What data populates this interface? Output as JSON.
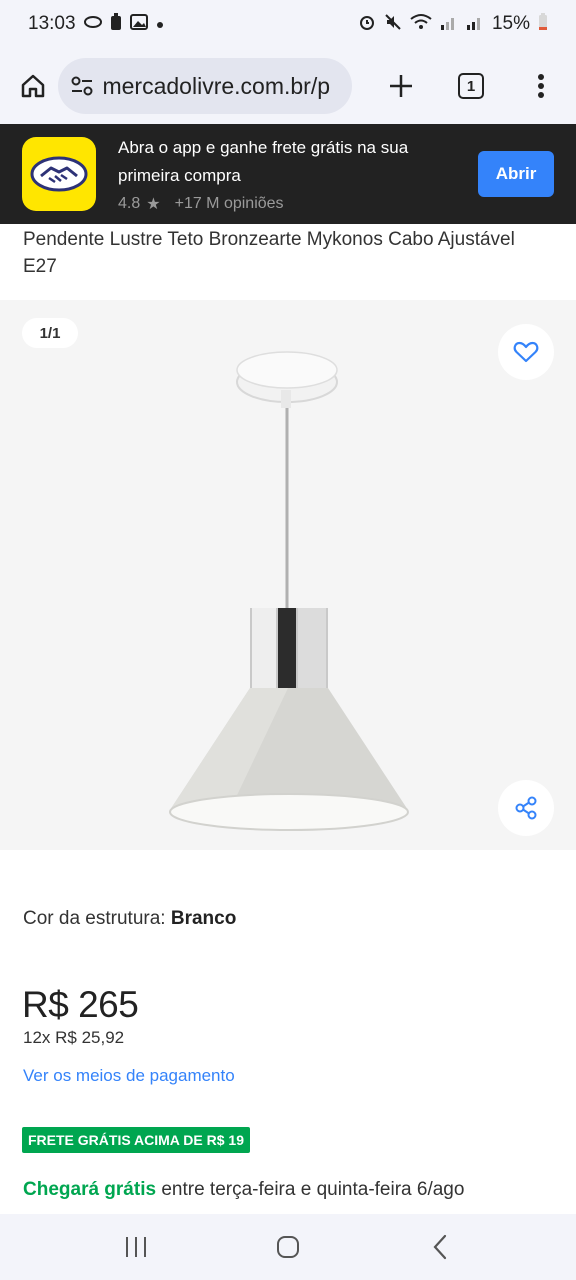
{
  "status_bar": {
    "time": "13:03",
    "battery": "15%",
    "icons_left": [
      "whatsapp-icon",
      "battery-saver-icon",
      "image-icon",
      "dot-icon"
    ],
    "icons_right": [
      "alarm-icon",
      "mute-icon",
      "wifi-icon",
      "signal-icon",
      "signal-icon"
    ]
  },
  "browser": {
    "url": "mercadolivre.com.br/p",
    "tab_count": "1"
  },
  "app_banner": {
    "title": "Abra o app e ganhe frete grátis na sua primeira compra",
    "rating": "4.8",
    "reviews": "+17 M opiniões",
    "open_label": "Abrir",
    "brand_color": "#ffe600",
    "button_color": "#3483fa"
  },
  "product": {
    "title": "Pendente Lustre Teto Bronzearte Mykonos Cabo Ajustável E27",
    "image_counter": "1/1",
    "variant_label": "Cor da estrutura: ",
    "variant_value": "Branco",
    "price": "R$ 265",
    "installments": "12x R$ 25,92",
    "payment_link": "Ver os meios de pagamento",
    "free_shipping_badge": "FRETE GRÁTIS ACIMA DE R$ 19",
    "delivery_highlight": "Chegará grátis",
    "delivery_text": " entre terça-feira e quinta-feira 6/ago",
    "accent_green": "#00a650"
  },
  "nav": {
    "buttons": [
      "recent-apps",
      "home",
      "back"
    ]
  }
}
